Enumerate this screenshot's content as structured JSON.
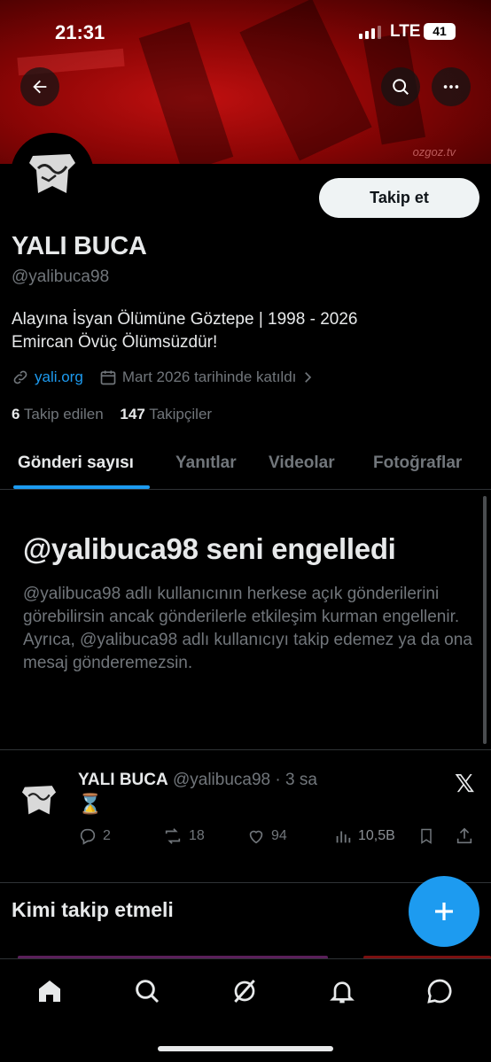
{
  "status_bar": {
    "time": "21:31",
    "network": "LTE",
    "battery": "41"
  },
  "banner": {
    "watermark": "ozgoz.tv"
  },
  "profile": {
    "name": "YALI BUCA",
    "handle": "@yalibuca98",
    "follow_label": "Takip et",
    "bio_line1": "Alayına İsyan Ölümüne Göztepe | 1998 - 2026",
    "bio_line2": "Emircan Övüç Ölümsüzdür!",
    "link": "yali.org",
    "joined": "Mart 2026 tarihinde katıldı",
    "following_count": "6",
    "following_label": "Takip edilen",
    "followers_count": "147",
    "followers_label": "Takipçiler"
  },
  "tabs": [
    {
      "label": "Gönderi sayısı",
      "active": true
    },
    {
      "label": "Yanıtlar",
      "active": false
    },
    {
      "label": "Videolar",
      "active": false
    },
    {
      "label": "Fotoğraflar",
      "active": false
    }
  ],
  "blocked": {
    "title": "@yalibuca98 seni engelledi",
    "text": "@yalibuca98 adlı kullanıcının herkese açık gönderilerini görebilirsin ancak gönderilerle etkileşim kurman engellenir. Ayrıca, @yalibuca98 adlı kullanıcıyı takip edemez ya da ona mesaj gönderemezsin."
  },
  "tweet": {
    "name": "YALI BUCA",
    "handle_time": "@yalibuca98 · 3 sa",
    "content": "⌛",
    "replies": "2",
    "reposts": "18",
    "likes": "94",
    "views": "10,5B"
  },
  "who_to_follow": "Kimi takip etmeli",
  "colors": {
    "accent": "#1d9bf0",
    "muted": "#71767b",
    "text": "#e7e9ea",
    "border": "#2f3336"
  },
  "icons": [
    "back-arrow-icon",
    "search-icon",
    "more-icon",
    "link-icon",
    "calendar-icon",
    "chevron-right-icon",
    "reply-icon",
    "repost-icon",
    "like-icon",
    "views-icon",
    "bookmark-icon",
    "share-icon",
    "x-logo-icon",
    "plus-icon",
    "home-icon",
    "explore-icon",
    "grok-icon",
    "notifications-icon",
    "messages-icon"
  ]
}
